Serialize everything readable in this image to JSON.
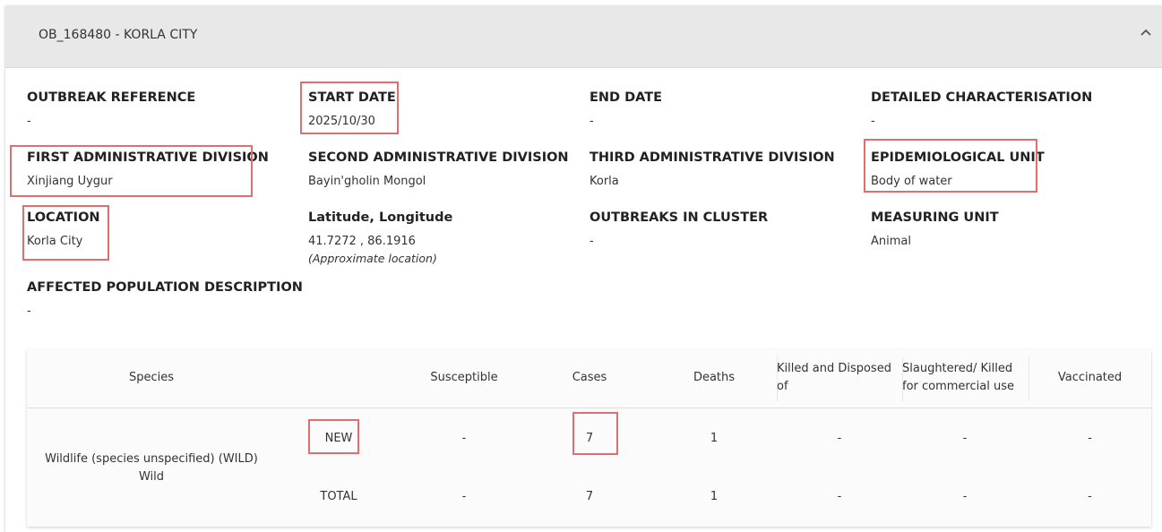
{
  "header": {
    "title": "OB_168480 - KORLA CITY"
  },
  "fields": [
    {
      "label": "OUTBREAK REFERENCE",
      "value": "-"
    },
    {
      "label": "START DATE",
      "value": "2025/10/30"
    },
    {
      "label": "END DATE",
      "value": "-"
    },
    {
      "label": "DETAILED CHARACTERISATION",
      "value": "-"
    },
    {
      "label": "FIRST ADMINISTRATIVE DIVISION",
      "value": "Xinjiang Uygur"
    },
    {
      "label": "SECOND ADMINISTRATIVE DIVISION",
      "value": "Bayin'gholin Mongol"
    },
    {
      "label": "THIRD ADMINISTRATIVE DIVISION",
      "value": "Korla"
    },
    {
      "label": "EPIDEMIOLOGICAL UNIT",
      "value": "Body of water"
    },
    {
      "label": "LOCATION",
      "value": "Korla City"
    },
    {
      "label": "Latitude, Longitude",
      "value": "41.7272 , 86.1916",
      "note": "(Approximate location)"
    },
    {
      "label": "OUTBREAKS IN CLUSTER",
      "value": "-"
    },
    {
      "label": "MEASURING UNIT",
      "value": "Animal"
    },
    {
      "label": "AFFECTED POPULATION DESCRIPTION",
      "value": "-"
    }
  ],
  "table": {
    "headers": {
      "species": "Species",
      "susceptible": "Susceptible",
      "cases": "Cases",
      "deaths": "Deaths",
      "killed_line1": "Killed and Disposed",
      "killed_line2": "of",
      "slaughtered_line1": "Slaughtered/ Killed",
      "slaughtered_line2": "for commercial use",
      "vaccinated": "Vaccinated"
    },
    "species_line1": "Wildlife (species unspecified) (WILD)",
    "species_line2": "Wild",
    "rows": [
      {
        "type": "NEW",
        "susceptible": "-",
        "cases": "7",
        "deaths": "1",
        "killed": "-",
        "slaughtered": "-",
        "vaccinated": "-"
      },
      {
        "type": "TOTAL",
        "susceptible": "-",
        "cases": "7",
        "deaths": "1",
        "killed": "-",
        "slaughtered": "-",
        "vaccinated": "-"
      }
    ]
  },
  "colors": {
    "highlight": "#e06e6e",
    "header_bg": "#e8e8e8"
  }
}
